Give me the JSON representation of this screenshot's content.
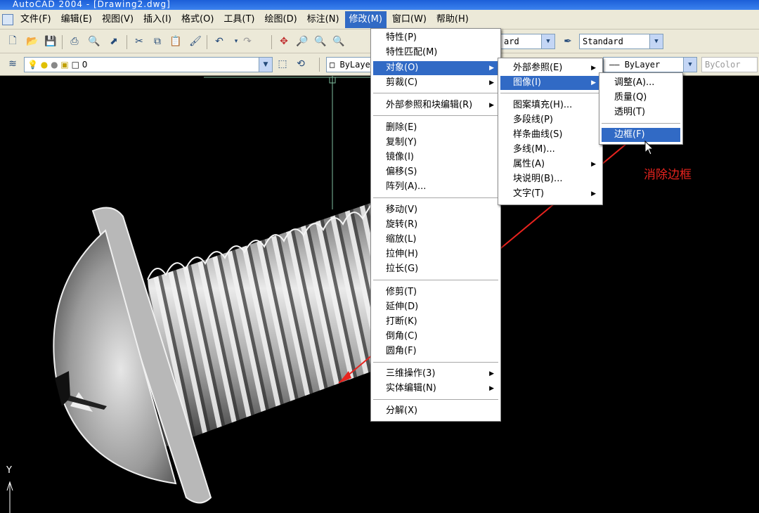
{
  "window": {
    "title": "AutoCAD 2004 - [Drawing2.dwg]"
  },
  "menubar": {
    "items": [
      {
        "label": "文件(F)"
      },
      {
        "label": "编辑(E)"
      },
      {
        "label": "视图(V)"
      },
      {
        "label": "插入(I)"
      },
      {
        "label": "格式(O)"
      },
      {
        "label": "工具(T)"
      },
      {
        "label": "绘图(D)"
      },
      {
        "label": "标注(N)"
      },
      {
        "label": "修改(M)"
      },
      {
        "label": "窗口(W)"
      },
      {
        "label": "帮助(H)"
      }
    ]
  },
  "toolbar": {
    "text_style": "Standard",
    "dim_style_partial": "ard",
    "layer_value": "0",
    "color_value": "ByLayer",
    "linetype_value": "ByLayer",
    "lineweight_value": "ByColor"
  },
  "modify_menu": {
    "items": [
      {
        "label": "特性(P)"
      },
      {
        "label": "特性匹配(M)"
      },
      {
        "label": "对象(O)"
      },
      {
        "label": "剪裁(C)"
      },
      {
        "label": "外部参照和块编辑(R)"
      },
      {
        "label": "删除(E)"
      },
      {
        "label": "复制(Y)"
      },
      {
        "label": "镜像(I)"
      },
      {
        "label": "偏移(S)"
      },
      {
        "label": "阵列(A)..."
      },
      {
        "label": "移动(V)"
      },
      {
        "label": "旋转(R)"
      },
      {
        "label": "缩放(L)"
      },
      {
        "label": "拉伸(H)"
      },
      {
        "label": "拉长(G)"
      },
      {
        "label": "修剪(T)"
      },
      {
        "label": "延伸(D)"
      },
      {
        "label": "打断(K)"
      },
      {
        "label": "倒角(C)"
      },
      {
        "label": "圆角(F)"
      },
      {
        "label": "三维操作(3)"
      },
      {
        "label": "实体编辑(N)"
      },
      {
        "label": "分解(X)"
      }
    ]
  },
  "object_menu": {
    "items": [
      {
        "label": "外部参照(E)"
      },
      {
        "label": "图像(I)"
      },
      {
        "label": "图案填充(H)..."
      },
      {
        "label": "多段线(P)"
      },
      {
        "label": "样条曲线(S)"
      },
      {
        "label": "多线(M)..."
      },
      {
        "label": "属性(A)"
      },
      {
        "label": "块说明(B)..."
      },
      {
        "label": "文字(T)"
      }
    ]
  },
  "image_menu": {
    "items": [
      {
        "label": "调整(A)..."
      },
      {
        "label": "质量(Q)"
      },
      {
        "label": "透明(T)"
      },
      {
        "label": "边框(F)"
      }
    ]
  },
  "annotation": {
    "text": "消除边框",
    "color": "#e8231e"
  },
  "ucs": {
    "y_label": "Y"
  },
  "colors": {
    "menu_highlight": "#316ac5",
    "chrome": "#ece9d8"
  }
}
